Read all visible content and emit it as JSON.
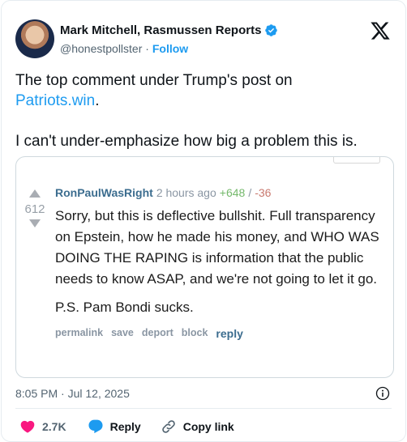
{
  "tweet": {
    "author_name": "Mark Mitchell, Rasmussen Reports",
    "handle": "@honestpollster",
    "handle_sep": "·",
    "follow_label": "Follow",
    "text_line1_prefix": "The top comment under Trump's post on",
    "text_link": "Patriots.win",
    "text_line1_suffix": ".",
    "text_para2": "I can't under-emphasize how big a problem this is.",
    "timestamp": "8:05 PM · Jul 12, 2025",
    "likes": "2.7K",
    "reply_label": "Reply",
    "copy_link_label": "Copy link",
    "colors": {
      "accent": "#1d9bf0",
      "like": "#f91880"
    }
  },
  "comment": {
    "author": "RonPaulWasRight",
    "time": "2 hours ago",
    "upvotes": "+648",
    "separator": "/",
    "downvotes": "-36",
    "score": "612",
    "body": "Sorry, but this is deflective bullshit. Full transparency on Epstein, how he made his money, and WHO WAS DOING THE RAPING is information that the public needs to know ASAP, and we're not going to let it go.",
    "ps": "P.S. Pam Bondi sucks.",
    "actions": {
      "permalink": "permalink",
      "save": "save",
      "deport": "deport",
      "block": "block",
      "reply": "reply"
    }
  }
}
